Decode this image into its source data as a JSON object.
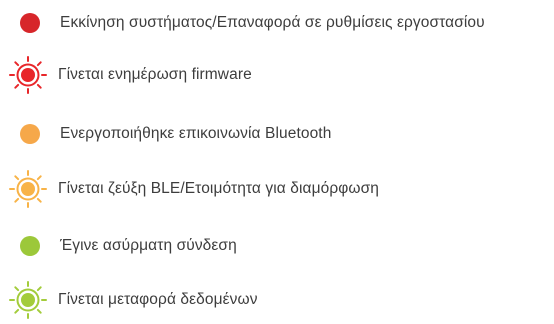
{
  "legend": {
    "items": [
      {
        "icon": "red-solid-dot-icon",
        "state": "solid",
        "color": "#d7262a",
        "text": "Εκκίνηση συστήματος/Επαναφορά σε ρυθμίσεις εργοστασίου"
      },
      {
        "icon": "red-blinking-dot-icon",
        "state": "blinking",
        "color": "#e8262a",
        "text": "Γίνεται ενημέρωση firmware"
      },
      {
        "icon": "orange-solid-dot-icon",
        "state": "solid",
        "color": "#f6a84a",
        "text": "Ενεργοποιήθηκε επικοινωνία Bluetooth"
      },
      {
        "icon": "orange-blinking-dot-icon",
        "state": "blinking",
        "color": "#f8b347",
        "text": "Γίνεται ζεύξη BLE/Ετοιμότητα για διαμόρφωση"
      },
      {
        "icon": "green-solid-dot-icon",
        "state": "solid",
        "color": "#9cc83a",
        "text": "Έγινε ασύρματη σύνδεση"
      },
      {
        "icon": "green-blinking-dot-icon",
        "state": "blinking",
        "color": "#a3cc3b",
        "text": "Γίνεται μεταφορά δεδομένων"
      }
    ]
  }
}
